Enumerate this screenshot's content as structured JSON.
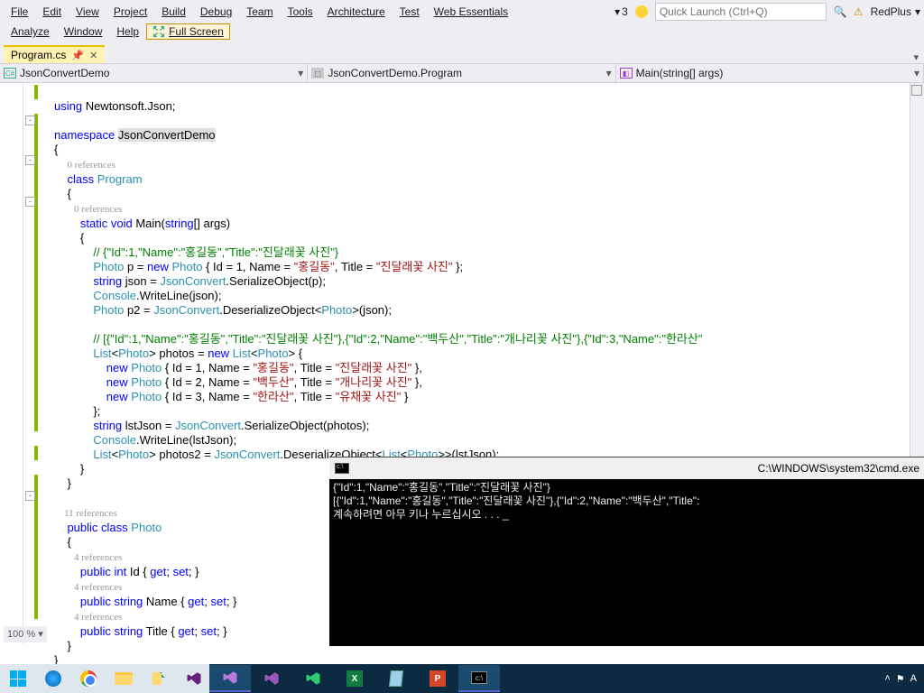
{
  "menu": {
    "row1": [
      "File",
      "Edit",
      "View",
      "Project",
      "Build",
      "Debug",
      "Team",
      "Tools",
      "Architecture",
      "Test",
      "Web Essentials"
    ],
    "row2": [
      "Analyze",
      "Window",
      "Help"
    ],
    "fullscreen": "Full Screen",
    "notify_count": "3",
    "quicklaunch_placeholder": "Quick Launch (Ctrl+Q)",
    "user": "RedPlus"
  },
  "tabs": {
    "active": "Program.cs"
  },
  "nav": {
    "a": "JsonConvertDemo",
    "b": "JsonConvertDemo.Program",
    "c": "Main(string[] args)"
  },
  "code": {
    "l01a": "using",
    "l01b": " Newtonsoft.Json;",
    "l03a": "namespace",
    "l03b": " ",
    "l03c": "JsonConvertDemo",
    "l04": "{",
    "l05r": "0 references",
    "l06a": "    class",
    "l06b": " ",
    "l06c": "Program",
    "l07": "    {",
    "l08r": "        0 references",
    "l09a": "        static",
    "l09b": " ",
    "l09c": "void",
    "l09d": " Main(",
    "l09e": "string",
    "l09f": "[] args)",
    "l10": "        {",
    "l11c": "            // {\"Id\":1,\"Name\":\"홍길동\",\"Title\":\"진달래꽃 사진\"}",
    "l12a": "            ",
    "l12b": "Photo",
    "l12c": " p = ",
    "l12d": "new",
    "l12e": " ",
    "l12f": "Photo",
    "l12g": " { Id = 1, Name = ",
    "l12h": "\"홍길동\"",
    "l12i": ", Title = ",
    "l12j": "\"진달래꽃 사진\"",
    "l12k": " };",
    "l13a": "            ",
    "l13b": "string",
    "l13c": " json = ",
    "l13d": "JsonConvert",
    "l13e": ".SerializeObject(p);",
    "l14a": "            ",
    "l14b": "Console",
    "l14c": ".WriteLine(json);",
    "l15a": "            ",
    "l15b": "Photo",
    "l15c": " p2 = ",
    "l15d": "JsonConvert",
    "l15e": ".DeserializeObject<",
    "l15f": "Photo",
    "l15g": ">(json);",
    "l17c": "            // [{\"Id\":1,\"Name\":\"홍길동\",\"Title\":\"진달래꽃 사진\"},{\"Id\":2,\"Name\":\"백두산\",\"Title\":\"개나리꽃 사진\"},{\"Id\":3,\"Name\":\"한라산\"",
    "l18a": "            ",
    "l18b": "List",
    "l18c": "<",
    "l18d": "Photo",
    "l18e": "> photos = ",
    "l18f": "new",
    "l18g": " ",
    "l18h": "List",
    "l18i": "<",
    "l18j": "Photo",
    "l18k": "> {",
    "l19a": "                ",
    "l19b": "new",
    "l19c": " ",
    "l19d": "Photo",
    "l19e": " { Id = 1, Name = ",
    "l19f": "\"홍길동\"",
    "l19g": ", Title = ",
    "l19h": "\"진달래꽃 사진\"",
    "l19i": " },",
    "l20a": "                ",
    "l20b": "new",
    "l20c": " ",
    "l20d": "Photo",
    "l20e": " { Id = 2, Name = ",
    "l20f": "\"백두산\"",
    "l20g": ", Title = ",
    "l20h": "\"개나리꽃 사진\"",
    "l20i": " },",
    "l21a": "                ",
    "l21b": "new",
    "l21c": " ",
    "l21d": "Photo",
    "l21e": " { Id = 3, Name = ",
    "l21f": "\"한라산\"",
    "l21g": ", Title = ",
    "l21h": "\"유채꽃 사진\"",
    "l21i": " }",
    "l22": "            };",
    "l23a": "            ",
    "l23b": "string",
    "l23c": " lstJson = ",
    "l23d": "JsonConvert",
    "l23e": ".SerializeObject(photos);",
    "l24a": "            ",
    "l24b": "Console",
    "l24c": ".WriteLine(lstJson);",
    "l25a": "            ",
    "l25b": "List",
    "l25c": "<",
    "l25d": "Photo",
    "l25e": "> photos2 = ",
    "l25f": "JsonConvert",
    "l25g": ".DeserializeObject<",
    "l25h": "List",
    "l25i": "<",
    "l25j": "Photo",
    "l25k": ">>(lstJson);",
    "l26": "        }",
    "l27": "    }",
    "l29r": "    11 references",
    "l30a": "    public",
    "l30b": " ",
    "l30c": "class",
    "l30d": " ",
    "l30e": "Photo",
    "l31": "    {",
    "l32r": "        4 references",
    "l33a": "        public",
    "l33b": " ",
    "l33c": "int",
    "l33d": " Id { ",
    "l33e": "get",
    "l33f": "; ",
    "l33g": "set",
    "l33h": "; }",
    "l34r": "        4 references",
    "l35a": "        public",
    "l35b": " ",
    "l35c": "string",
    "l35d": " Name { ",
    "l35e": "get",
    "l35f": "; ",
    "l35g": "set",
    "l35h": "; }",
    "l36r": "        4 references",
    "l37a": "        public",
    "l37b": " ",
    "l37c": "string",
    "l37d": " Title { ",
    "l37e": "get",
    "l37f": "; ",
    "l37g": "set",
    "l37h": "; }",
    "l38": "    }",
    "l39": "}"
  },
  "zoom": "100 %",
  "console": {
    "title_path": "C:\\WINDOWS\\system32\\cmd.exe",
    "line1": "{\"Id\":1,\"Name\":\"홍길동\",\"Title\":\"진달래꽃 사진\"}",
    "line2": "[{\"Id\":1,\"Name\":\"홍길동\",\"Title\":\"진달래꽃 사진\"},{\"Id\":2,\"Name\":\"백두산\",\"Title\":",
    "line3": "계속하려면 아무 키나 누르십시오 . . . _"
  },
  "tray": {
    "lang": "A"
  }
}
